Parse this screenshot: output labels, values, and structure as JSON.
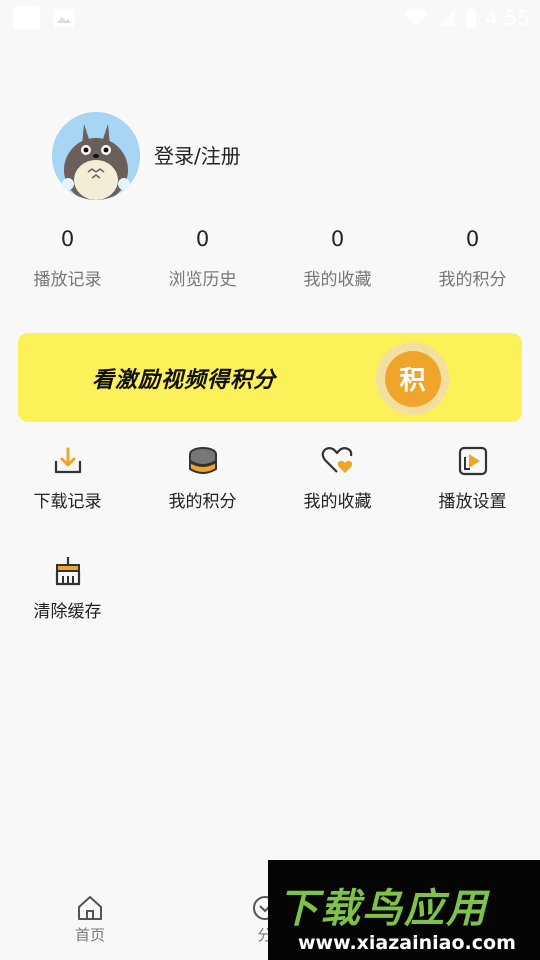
{
  "status_bar": {
    "time": "4:55"
  },
  "profile": {
    "login_label": "登录/注册"
  },
  "stats": [
    {
      "value": "0",
      "label": "播放记录"
    },
    {
      "value": "0",
      "label": "浏览历史"
    },
    {
      "value": "0",
      "label": "我的收藏"
    },
    {
      "value": "0",
      "label": "我的积分"
    }
  ],
  "banner": {
    "text": "看激励视频得积分",
    "coin_label": "积"
  },
  "menu": [
    {
      "label": "下载记录",
      "icon": "download-icon"
    },
    {
      "label": "我的积分",
      "icon": "coins-icon"
    },
    {
      "label": "我的收藏",
      "icon": "heart-icon"
    },
    {
      "label": "播放设置",
      "icon": "play-settings-icon"
    },
    {
      "label": "清除缓存",
      "icon": "broom-icon"
    }
  ],
  "tabbar": {
    "tabs": [
      {
        "label": "首页",
        "icon": "home-icon"
      },
      {
        "label": "分",
        "icon": "category-icon"
      }
    ]
  },
  "watermark": {
    "title": "下载鸟应用",
    "url": "www.xiazainiao.com"
  },
  "colors": {
    "accent": "#efa52b",
    "banner": "#fdf15a",
    "avatar_bg": "#a7d5f3"
  }
}
